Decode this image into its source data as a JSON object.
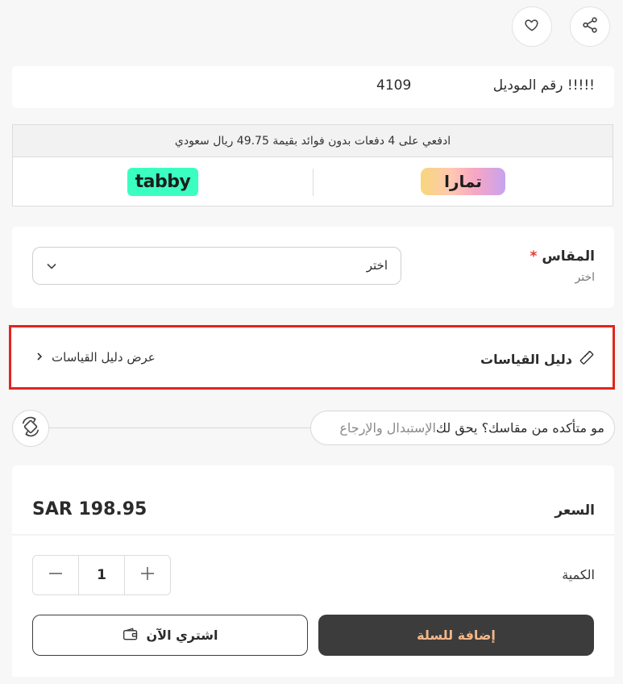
{
  "header": {
    "share_icon": "share-icon",
    "wishlist_icon": "heart-icon"
  },
  "model": {
    "label": "!!!!! رقم الموديل",
    "value": "4109"
  },
  "installments": {
    "text": "ادفعي على 4 دفعات بدون فوائد بقيمة 49.75 ريال سعودي",
    "tabby_label": "tabby",
    "tamara_label": "تمارا"
  },
  "size": {
    "label": "المقاس",
    "required_mark": "*",
    "sub": "اختر",
    "select_value": "اختر"
  },
  "size_guide": {
    "title": "دليل القياسات",
    "link": "عرض دليل القياسات"
  },
  "exchange": {
    "text_main": "مو متأكده من مقاسك؟ يحق لك ",
    "text_accent": "الإستبدال والإرجاع"
  },
  "price": {
    "label": "السعر",
    "value": "SAR 198.95"
  },
  "quantity": {
    "label": "الكمية",
    "value": "1",
    "minus": "—",
    "plus": "+"
  },
  "actions": {
    "add_to_cart": "إضافة للسلة",
    "buy_now": "اشتري الآن"
  },
  "colors": {
    "accent_red": "#e1251b",
    "dark_button": "#3c3c3c",
    "add_text": "#f2b78a",
    "tabby_green": "#3bffc1"
  }
}
